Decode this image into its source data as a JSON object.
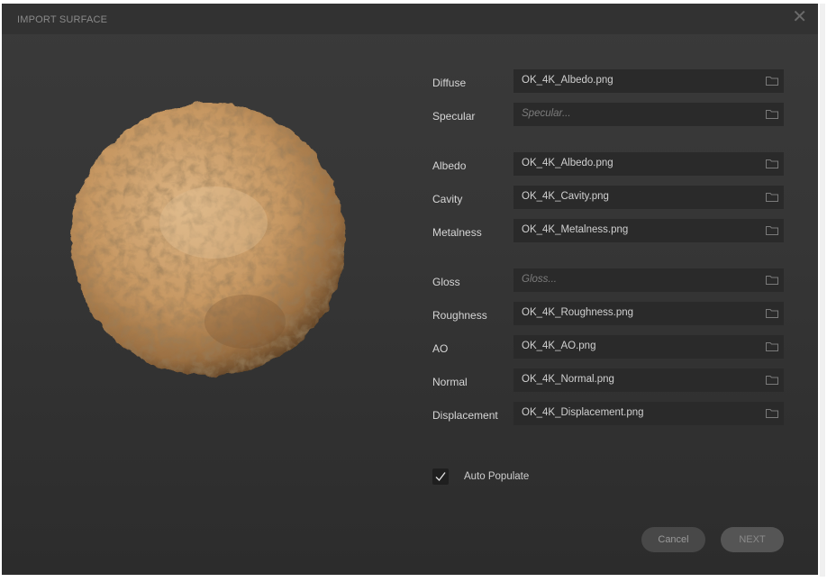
{
  "window": {
    "title": "IMPORT SURFACE",
    "close_glyph": "✕"
  },
  "preview": {
    "icon": "material-sphere-preview",
    "base_color": "#c79a64"
  },
  "maps": [
    {
      "label": "Diffuse",
      "value": "OK_4K_Albedo.png",
      "placeholder": "",
      "icon": "folder-icon"
    },
    {
      "label": "Specular",
      "value": "",
      "placeholder": "Specular...",
      "icon": "folder-icon"
    },
    {
      "label": "Albedo",
      "value": "OK_4K_Albedo.png",
      "placeholder": "",
      "icon": "folder-icon"
    },
    {
      "label": "Cavity",
      "value": "OK_4K_Cavity.png",
      "placeholder": "",
      "icon": "folder-icon"
    },
    {
      "label": "Metalness",
      "value": "OK_4K_Metalness.png",
      "placeholder": "",
      "icon": "folder-icon"
    },
    {
      "label": "Gloss",
      "value": "",
      "placeholder": "Gloss...",
      "icon": "folder-icon"
    },
    {
      "label": "Roughness",
      "value": "OK_4K_Roughness.png",
      "placeholder": "",
      "icon": "folder-icon"
    },
    {
      "label": "AO",
      "value": "OK_4K_AO.png",
      "placeholder": "",
      "icon": "folder-icon"
    },
    {
      "label": "Normal",
      "value": "OK_4K_Normal.png",
      "placeholder": "",
      "icon": "folder-icon"
    },
    {
      "label": "Displacement",
      "value": "OK_4K_Displacement.png",
      "placeholder": "",
      "icon": "folder-icon"
    }
  ],
  "auto_populate": {
    "label": "Auto Populate",
    "checked": true
  },
  "buttons": {
    "cancel": "Cancel",
    "next": "NEXT"
  },
  "colors": {
    "background": "#363636",
    "field": "#2a2a2a",
    "text": "#d6d6d6"
  }
}
